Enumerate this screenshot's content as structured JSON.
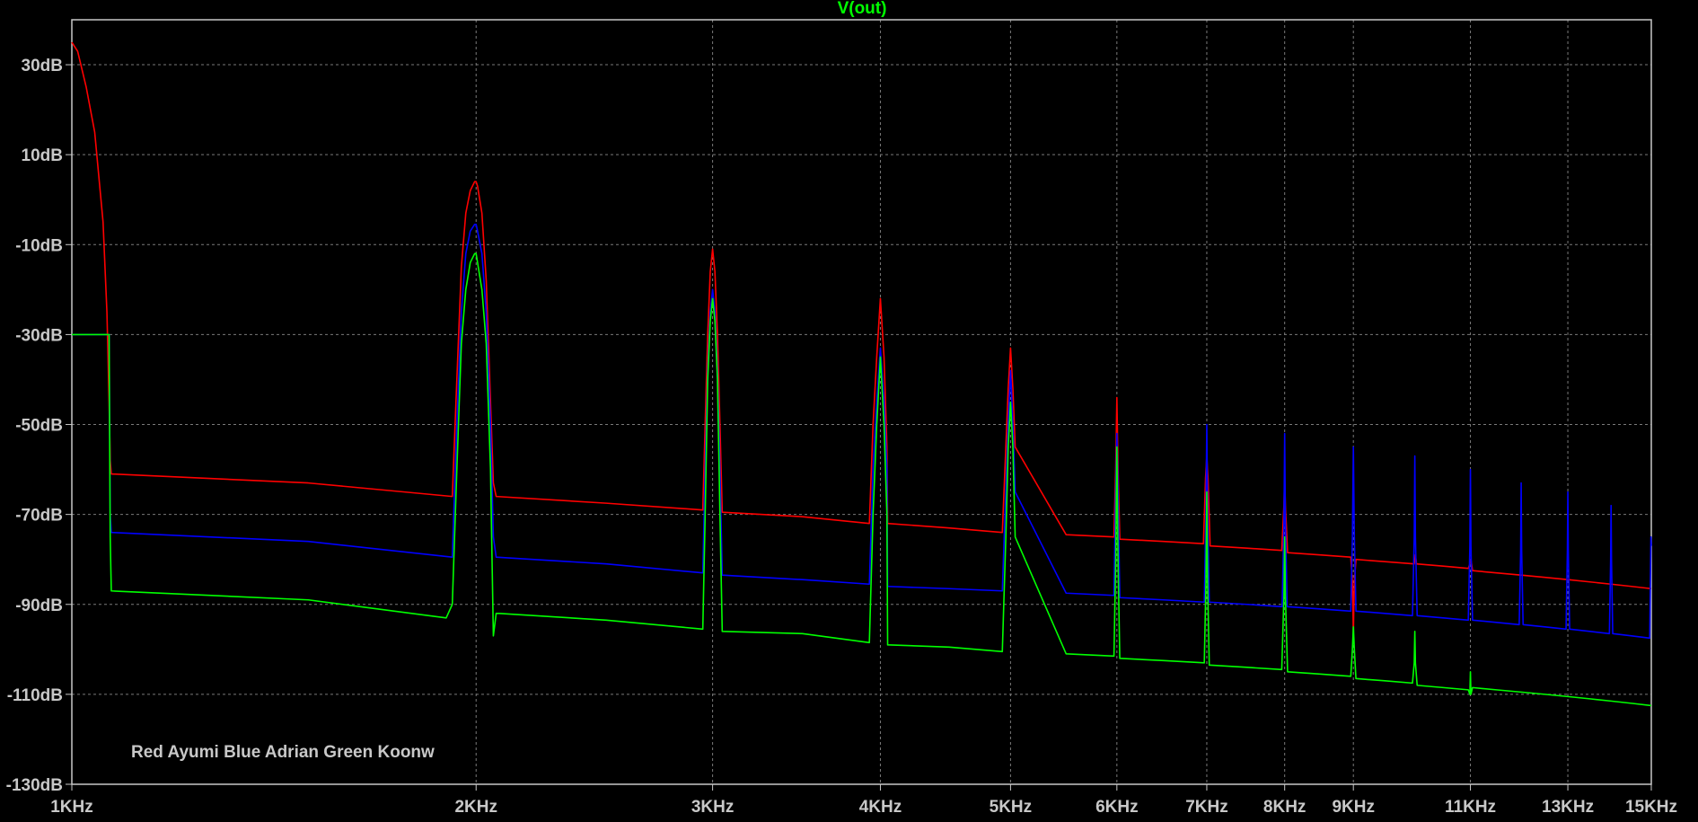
{
  "chart_data": {
    "type": "line",
    "title": "V(out)",
    "title_color": "#00ff00",
    "background_color": "#000000",
    "grid": true,
    "grid_color": "#7a7a7a",
    "x_scale": "log",
    "xlim": [
      1000,
      15000
    ],
    "ylim": [
      -130,
      40
    ],
    "x_ticks": [
      {
        "value": 1000,
        "label": "1KHz"
      },
      {
        "value": 2000,
        "label": "2KHz"
      },
      {
        "value": 3000,
        "label": "3KHz"
      },
      {
        "value": 4000,
        "label": "4KHz"
      },
      {
        "value": 5000,
        "label": "5KHz"
      },
      {
        "value": 6000,
        "label": "6KHz"
      },
      {
        "value": 7000,
        "label": "7KHz"
      },
      {
        "value": 8000,
        "label": "8KHz"
      },
      {
        "value": 9000,
        "label": "9KHz"
      },
      {
        "value": 11000,
        "label": "11KHz"
      },
      {
        "value": 13000,
        "label": "13KHz"
      },
      {
        "value": 15000,
        "label": "15KHz"
      }
    ],
    "y_ticks": [
      {
        "value": 30,
        "label": "30dB"
      },
      {
        "value": 10,
        "label": "10dB"
      },
      {
        "value": -10,
        "label": "-10dB"
      },
      {
        "value": -30,
        "label": "-30dB"
      },
      {
        "value": -50,
        "label": "-50dB"
      },
      {
        "value": -70,
        "label": "-70dB"
      },
      {
        "value": -90,
        "label": "-90dB"
      },
      {
        "value": -110,
        "label": "-110dB"
      },
      {
        "value": -130,
        "label": "-130dB"
      }
    ],
    "annotation": "Red Ayumi Blue Adrian Green Koonw",
    "series": [
      {
        "color": "#ff0000",
        "x": [
          1000,
          1010,
          1025,
          1040,
          1055,
          1062,
          1066,
          1068,
          1070,
          1500,
          1920,
          1935,
          1950,
          1965,
          1980,
          1995,
          2000,
          2005,
          2020,
          2035,
          2050,
          2060,
          2070,
          2500,
          2950,
          2962,
          2975,
          2988,
          3000,
          3012,
          3025,
          3038,
          3050,
          3500,
          3925,
          3950,
          3975,
          4000,
          4025,
          4045,
          4050,
          4500,
          4930,
          4960,
          4980,
          5000,
          5020,
          5040,
          5500,
          5970,
          5988,
          6000,
          6012,
          6030,
          6500,
          6960,
          6985,
          7000,
          7015,
          7040,
          7500,
          7960,
          7990,
          8000,
          8010,
          8040,
          8500,
          8960,
          8985,
          8995,
          9000,
          9005,
          9015,
          9040,
          9500,
          9990,
          10010,
          10030,
          10500,
          10960,
          10990,
          11010,
          11040,
          11500,
          12000,
          12500,
          13000,
          13500,
          14000,
          14500,
          15000
        ],
        "y": [
          35,
          33,
          25,
          15,
          -5,
          -25,
          -45,
          -58,
          -61,
          -63,
          -66,
          -40,
          -15,
          -3,
          2,
          4,
          4,
          3,
          -3,
          -18,
          -45,
          -63,
          -66,
          -67.5,
          -69,
          -50,
          -30,
          -16,
          -11,
          -16,
          -30,
          -50,
          -69.5,
          -70.5,
          -72,
          -50,
          -35,
          -22,
          -35,
          -55,
          -72,
          -73,
          -74,
          -55,
          -42,
          -33,
          -42,
          -55,
          -74.5,
          -75,
          -60,
          -44,
          -60,
          -75.5,
          -76,
          -76.5,
          -62,
          -57,
          -62,
          -77,
          -77.5,
          -78,
          -68,
          -62,
          -68,
          -78.5,
          -79,
          -79.5,
          -85,
          -92,
          -97,
          -92,
          -85,
          -80,
          -80.5,
          -81,
          -79,
          -81,
          -81.5,
          -82,
          -81,
          -80,
          -82.5,
          -83,
          -83.5,
          -84,
          -84.5,
          -85,
          -85.5,
          -86,
          -86.5
        ]
      },
      {
        "color": "#0000ff",
        "x": [
          1000,
          1066,
          1068,
          1070,
          1500,
          1920,
          1935,
          1950,
          1965,
          1980,
          1995,
          2000,
          2005,
          2020,
          2035,
          2050,
          2060,
          2070,
          2500,
          2950,
          2962,
          2975,
          2988,
          3000,
          3012,
          3025,
          3038,
          3050,
          3500,
          3925,
          3950,
          3975,
          4000,
          4025,
          4045,
          4050,
          4500,
          4930,
          4960,
          4980,
          5000,
          5020,
          5040,
          5500,
          5970,
          5988,
          6000,
          6012,
          6030,
          6500,
          6970,
          6990,
          7000,
          7010,
          7030,
          7500,
          7965,
          7990,
          8000,
          8010,
          8035,
          8500,
          8960,
          8985,
          9000,
          9015,
          9040,
          9500,
          9960,
          9990,
          10000,
          10010,
          10040,
          10500,
          10960,
          10990,
          11000,
          11010,
          11040,
          11500,
          11960,
          11990,
          12000,
          12010,
          12040,
          12500,
          12960,
          12990,
          13000,
          13010,
          13040,
          13500,
          13960,
          13990,
          14000,
          14010,
          14040,
          14500,
          14960,
          14990,
          15000
        ],
        "y": [
          -30,
          -30,
          -70,
          -74,
          -76,
          -79.5,
          -50,
          -25,
          -12,
          -7,
          -5.5,
          -5.5,
          -7,
          -12,
          -25,
          -50,
          -75,
          -79.5,
          -81,
          -83,
          -60,
          -38,
          -25,
          -20,
          -25,
          -38,
          -60,
          -83.5,
          -84.5,
          -85.5,
          -60,
          -45,
          -33,
          -45,
          -60,
          -86,
          -86.5,
          -87,
          -65,
          -50,
          -38,
          -50,
          -65,
          -87.5,
          -88,
          -65,
          -52,
          -65,
          -88.5,
          -89,
          -89.5,
          -70,
          -50,
          -70,
          -89.5,
          -90,
          -90.5,
          -72,
          -52,
          -72,
          -90.5,
          -91,
          -91.5,
          -75,
          -55,
          -75,
          -91.5,
          -92,
          -92.5,
          -75,
          -57,
          -75,
          -92.5,
          -93,
          -93.5,
          -77,
          -60,
          -77,
          -93.5,
          -94,
          -94.5,
          -78,
          -63,
          -78,
          -94.5,
          -95,
          -95.5,
          -78,
          -65,
          -78,
          -95.5,
          -96,
          -96.5,
          -80,
          -68,
          -80,
          -96.5,
          -97,
          -97.5,
          -75,
          -77
        ]
      },
      {
        "color": "#00ff00",
        "x": [
          1000,
          1066,
          1068,
          1070,
          1500,
          1900,
          1920,
          1935,
          1950,
          1965,
          1980,
          1995,
          2000,
          2005,
          2020,
          2035,
          2050,
          2060,
          2070,
          2080,
          2500,
          2950,
          2962,
          2975,
          2988,
          3000,
          3012,
          3025,
          3038,
          3050,
          3500,
          3925,
          3950,
          3975,
          4000,
          4025,
          4045,
          4050,
          4500,
          4930,
          4960,
          4980,
          5000,
          5020,
          5040,
          5500,
          5970,
          5988,
          6000,
          6012,
          6030,
          6500,
          6970,
          6990,
          7000,
          7010,
          7030,
          7500,
          7960,
          7990,
          8000,
          8010,
          8040,
          8500,
          8960,
          8985,
          9000,
          9015,
          9040,
          9500,
          9960,
          9990,
          10000,
          10010,
          10040,
          10500,
          10960,
          10990,
          11000,
          11010,
          11040,
          11500,
          12000,
          12500,
          13000,
          13500,
          14000,
          14500,
          15000
        ],
        "y": [
          -30,
          -30,
          -75,
          -87,
          -89,
          -93,
          -90,
          -60,
          -32,
          -20,
          -14,
          -12,
          -12,
          -14,
          -20,
          -32,
          -60,
          -97,
          -92,
          -92,
          -93.5,
          -95.5,
          -70,
          -40,
          -27,
          -22,
          -27,
          -40,
          -70,
          -96,
          -96.5,
          -98.5,
          -70,
          -50,
          -35,
          -50,
          -70,
          -99,
          -99.5,
          -100.5,
          -75,
          -55,
          -45,
          -55,
          -75,
          -101,
          -101.5,
          -80,
          -55,
          -80,
          -102,
          -102.5,
          -103,
          -85,
          -65,
          -85,
          -103.5,
          -104,
          -104.5,
          -88,
          -75,
          -88,
          -105,
          -105.5,
          -106,
          -100,
          -95,
          -100,
          -106.5,
          -107,
          -107.5,
          -103,
          -96,
          -103,
          -108,
          -108.5,
          -109,
          -110,
          -105,
          -110,
          -108.5,
          -109,
          -109.5,
          -110,
          -110.5,
          -111,
          -111.5,
          -112,
          -112.5
        ]
      }
    ]
  }
}
